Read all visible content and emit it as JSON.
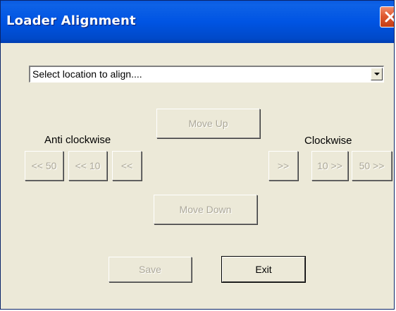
{
  "window": {
    "title": "Loader Alignment",
    "close_icon": "close-icon"
  },
  "location_select": {
    "selected": "Select location to align...."
  },
  "labels": {
    "anti_clockwise": "Anti clockwise",
    "clockwise": "Clockwise"
  },
  "buttons": {
    "move_up": "Move Up",
    "move_down": "Move Down",
    "ccw_50": "<< 50",
    "ccw_10": "<< 10",
    "ccw_1": "<<",
    "cw_1": ">>",
    "cw_10": "10 >>",
    "cw_50": "50 >>",
    "save": "Save",
    "exit": "Exit"
  },
  "colors": {
    "titlebar": "#0054e3",
    "dialog_bg": "#ece9d8",
    "close_button": "#e05a30",
    "disabled_text": "#aca899"
  }
}
